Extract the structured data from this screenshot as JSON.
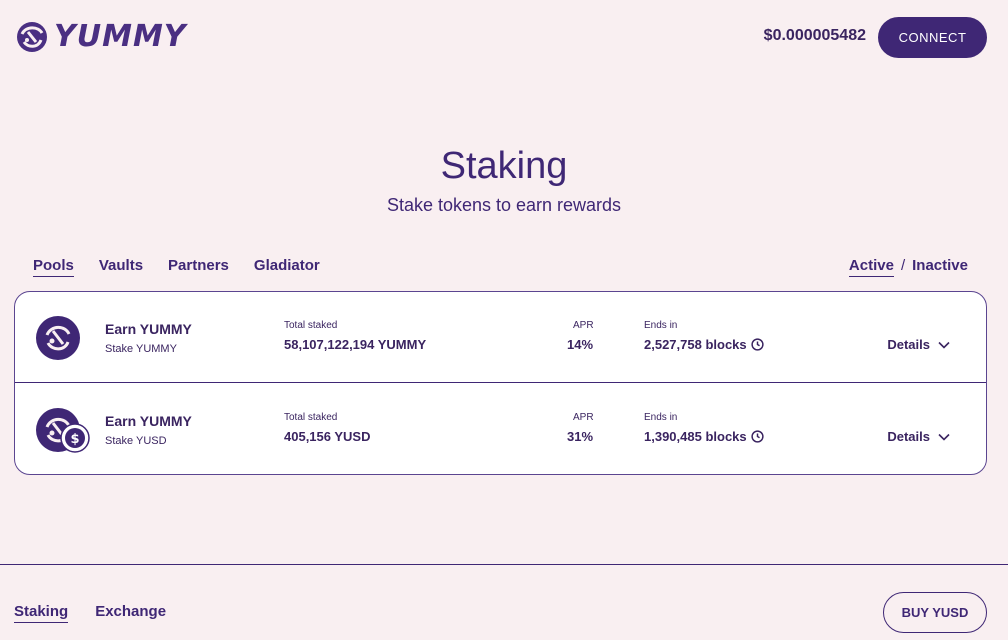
{
  "header": {
    "brand": "YUMMY",
    "price": "$0.000005482",
    "connect_label": "CONNECT"
  },
  "page": {
    "title": "Staking",
    "subtitle": "Stake tokens to earn rewards"
  },
  "tabs": [
    {
      "label": "Pools",
      "active": true
    },
    {
      "label": "Vaults",
      "active": false
    },
    {
      "label": "Partners",
      "active": false
    },
    {
      "label": "Gladiator",
      "active": false
    }
  ],
  "status_toggle": {
    "active_label": "Active",
    "separator": "/",
    "inactive_label": "Inactive"
  },
  "pools": [
    {
      "earn": "Earn YUMMY",
      "stake": "Stake YUMMY",
      "total_label": "Total staked",
      "total_value": "58,107,122,194 YUMMY",
      "apr_label": "APR",
      "apr_value": "14%",
      "ends_label": "Ends in",
      "ends_value": "2,527,758 blocks",
      "details_label": "Details",
      "icon": "yummy-coin-icon"
    },
    {
      "earn": "Earn YUMMY",
      "stake": "Stake YUSD",
      "total_label": "Total staked",
      "total_value": "405,156 YUSD",
      "apr_label": "APR",
      "apr_value": "31%",
      "ends_label": "Ends in",
      "ends_value": "1,390,485 blocks",
      "details_label": "Details",
      "icon": "yusd-coin-icon"
    }
  ],
  "footer": {
    "nav": [
      {
        "label": "Staking",
        "active": true
      },
      {
        "label": "Exchange",
        "active": false
      }
    ],
    "buy_label": "BUY YUSD"
  },
  "colors": {
    "background": "#f9eff1",
    "primary": "#3f2775",
    "card": "#ffffff"
  }
}
